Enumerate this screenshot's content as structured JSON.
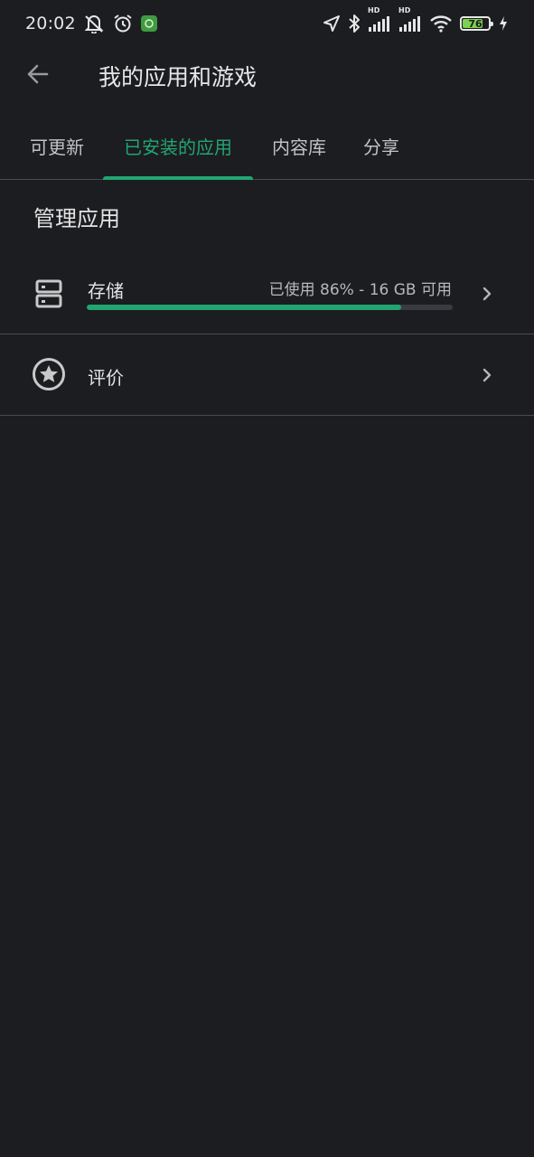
{
  "status_bar": {
    "time": "20:02",
    "battery_level": "76",
    "network_badge_1": "HD",
    "network_badge_2": "HD",
    "icons": [
      "notifications-off-icon",
      "alarm-icon",
      "app-notification-icon",
      "location-icon",
      "bluetooth-icon",
      "signal-icon",
      "signal-icon",
      "wifi-icon",
      "battery-icon",
      "charging-icon"
    ]
  },
  "header": {
    "title": "我的应用和游戏",
    "back_icon": "arrow-left-icon"
  },
  "tabs": [
    {
      "label": "可更新",
      "active": false
    },
    {
      "label": "已安装的应用",
      "active": true
    },
    {
      "label": "内容库",
      "active": false
    },
    {
      "label": "分享",
      "active": false
    }
  ],
  "section": {
    "title": "管理应用"
  },
  "storage": {
    "label": "存储",
    "info": "已使用 86% - 16 GB 可用",
    "used_fraction": 0.86
  },
  "ratings": {
    "label": "评价"
  },
  "colors": {
    "background": "#1c1d21",
    "accent": "#23a572",
    "divider": "#4a4b4f",
    "text": "#e3e3e3"
  }
}
